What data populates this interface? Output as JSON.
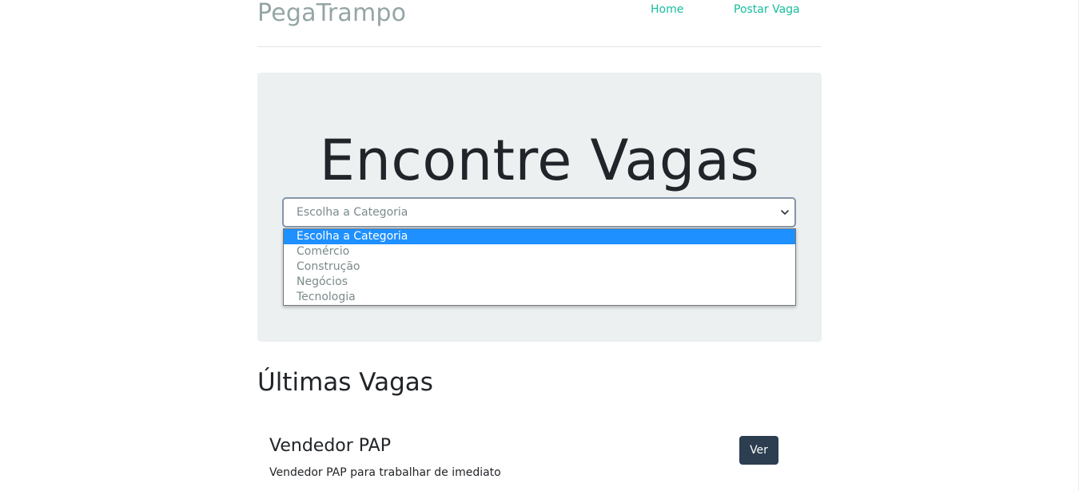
{
  "header": {
    "brand": "PegaTrampo",
    "nav": [
      {
        "label": "Home"
      },
      {
        "label": "Postar Vaga"
      }
    ]
  },
  "hero": {
    "title": "Encontre Vagas",
    "category_select": {
      "selected_value": "Escolha a Categoria",
      "options": [
        {
          "label": "Escolha a Categoria"
        },
        {
          "label": "Comércio"
        },
        {
          "label": "Construção"
        },
        {
          "label": "Negócios"
        },
        {
          "label": "Tecnologia"
        }
      ],
      "chevron_icon": "chevron-down-icon"
    }
  },
  "latest_jobs": {
    "title": "Últimas Vagas",
    "items": [
      {
        "title": "Vendedor PAP",
        "description": "Vendedor PAP para trabalhar de imediato",
        "button_label": "Ver"
      }
    ]
  },
  "colors": {
    "brand": "#95a5a6",
    "link": "#18bc9c",
    "jumbotron_bg": "#ecf0f1",
    "button_bg": "#2c3e50",
    "option_highlight": "#1e90ff"
  }
}
